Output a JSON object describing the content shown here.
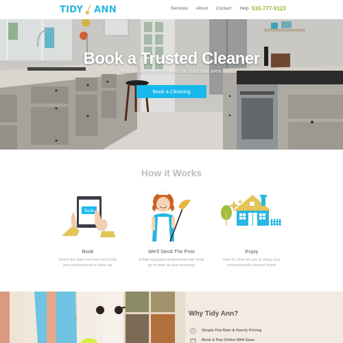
{
  "header": {
    "logo_left": "TIDY",
    "logo_right": "ANN",
    "nav": [
      "Services",
      "About",
      "Contact",
      "Help"
    ],
    "phone": "510-777-9123"
  },
  "hero": {
    "title": "Book a Trusted Cleaner",
    "subtitle": "We service Berkeley and the East Bay area",
    "cta": "Book a Cleaning"
  },
  "how_it_works": {
    "title": "How it Works",
    "steps": [
      {
        "title": "Book",
        "description": "Select the date and time you'd like your professional to show up.",
        "tablet_button": "Book"
      },
      {
        "title": "We'll Send The Pros",
        "description": "A fully-equipped professional will show up on time at your doorstep!"
      },
      {
        "title": "Enjoy",
        "description": "Now it's time for you to enjoy your professionally cleaned home"
      }
    ]
  },
  "why": {
    "title": "Why Tidy Ann?",
    "items": [
      {
        "icon": "clock-icon",
        "label": "Simple Flat Rate & Hourly Pricing"
      },
      {
        "icon": "calendar-icon",
        "label": "Book & Pay Online With Ease"
      }
    ]
  },
  "colors": {
    "brand_blue": "#29b6e3",
    "cta_blue": "#17b9ec",
    "phone_green": "#8dba2c",
    "accent_gold": "#e3c45a"
  }
}
